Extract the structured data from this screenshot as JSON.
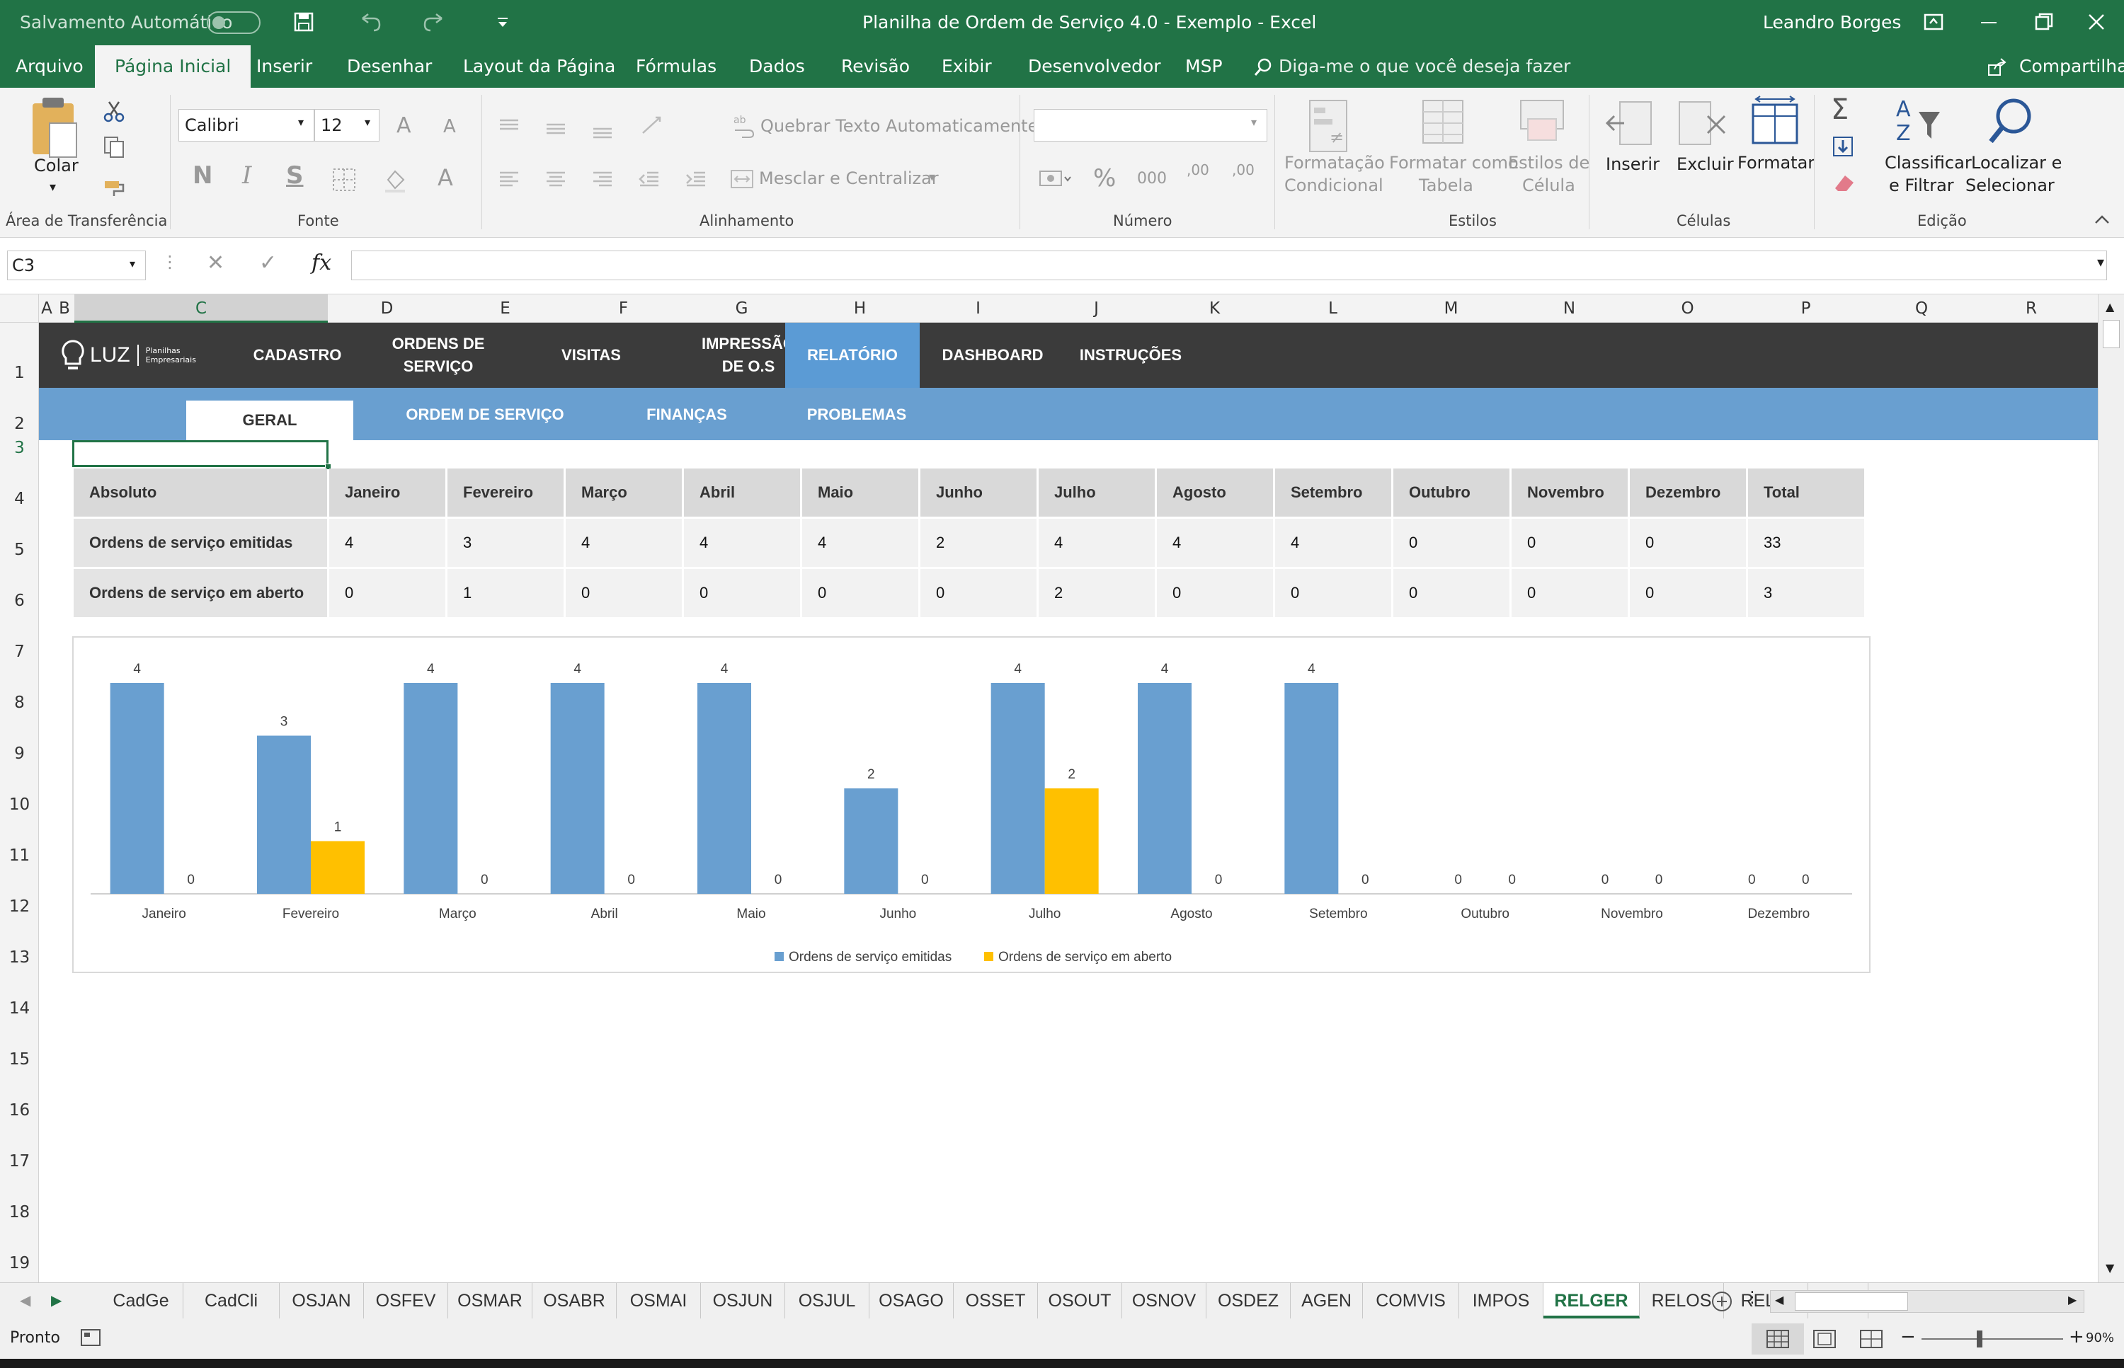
{
  "colors": {
    "excel_green": "#217346",
    "series_blue": "#699fd0",
    "series_yellow": "#ffc000",
    "nav_dark": "#3b3b3b",
    "nav_active": "#5b9bd5"
  },
  "titlebar": {
    "autosave_label": "Salvamento Automático",
    "window_title": "Planilha de Ordem de Serviço 4.0 - Exemplo  -  Excel",
    "user": "Leandro Borges",
    "share": "Compartilhar",
    "icons": [
      "save-icon",
      "undo-icon",
      "redo-icon",
      "customize-icon",
      "ribbon-display-icon",
      "minimize-icon",
      "restore-icon",
      "close-icon"
    ]
  },
  "ribbon_tabs": [
    "Arquivo",
    "Página Inicial",
    "Inserir",
    "Desenhar",
    "Layout da Página",
    "Fórmulas",
    "Dados",
    "Revisão",
    "Exibir",
    "Desenvolvedor",
    "MSP"
  ],
  "tell_me": "Diga-me o que você deseja fazer",
  "ribbon": {
    "clipboard": {
      "paste": "Colar",
      "label": "Área de Transferência"
    },
    "font": {
      "name": "Calibri",
      "size": "12",
      "bold": "N",
      "italic": "I",
      "underline": "S",
      "label": "Fonte"
    },
    "alignment": {
      "wrap": "Quebrar Texto Automaticamente",
      "merge": "Mesclar e Centralizar",
      "label": "Alinhamento"
    },
    "number": {
      "format": "",
      "percent": "%",
      "thousands": "000",
      "inc_decimal": ",00",
      "dec_decimal": ",00",
      "label": "Número"
    },
    "styles": {
      "conditional": "Formatação",
      "conditional2": "Condicional",
      "table": "Formatar como",
      "table2": "Tabela",
      "cell": "Estilos de",
      "cell2": "Célula",
      "label": "Estilos"
    },
    "cells": {
      "insert": "Inserir",
      "delete": "Excluir",
      "format": "Formatar",
      "label": "Células"
    },
    "editing": {
      "sort": "Classificar",
      "sort2": "e Filtrar",
      "find": "Localizar e",
      "find2": "Selecionar",
      "label": "Edição"
    }
  },
  "formula_bar": {
    "name_box": "C3",
    "fx": "fx",
    "value": ""
  },
  "columns": [
    "A",
    "B",
    "C",
    "D",
    "E",
    "F",
    "G",
    "H",
    "I",
    "J",
    "K",
    "L",
    "M",
    "N",
    "O",
    "P",
    "Q",
    "R"
  ],
  "rows": [
    "1",
    "2",
    "3",
    "4",
    "5",
    "6",
    "7",
    "8",
    "9",
    "10",
    "11",
    "12",
    "13",
    "14",
    "15",
    "16",
    "17",
    "18",
    "19"
  ],
  "nav": {
    "logo": "LUZ",
    "logo_sub": "Planilhas Empresariais",
    "items": [
      {
        "l1": "CADASTRO",
        "l2": ""
      },
      {
        "l1": "ORDENS DE",
        "l2": "SERVIÇO"
      },
      {
        "l1": "VISITAS",
        "l2": ""
      },
      {
        "l1": "IMPRESSÃO",
        "l2": "DE O.S"
      },
      {
        "l1": "RELATÓRIO",
        "l2": ""
      },
      {
        "l1": "DASHBOARD",
        "l2": ""
      },
      {
        "l1": "INSTRUÇÕES",
        "l2": ""
      }
    ]
  },
  "subnav": [
    "GERAL",
    "ORDEM DE SERVIÇO",
    "FINANÇAS",
    "PROBLEMAS"
  ],
  "table": {
    "headers": [
      "Absoluto",
      "Janeiro",
      "Fevereiro",
      "Março",
      "Abril",
      "Maio",
      "Junho",
      "Julho",
      "Agosto",
      "Setembro",
      "Outubro",
      "Novembro",
      "Dezembro",
      "Total"
    ],
    "rows": [
      {
        "label": "Ordens de serviço emitidas",
        "values": [
          "4",
          "3",
          "4",
          "4",
          "4",
          "2",
          "4",
          "4",
          "4",
          "0",
          "0",
          "0",
          "33"
        ]
      },
      {
        "label": "Ordens de serviço em aberto",
        "values": [
          "0",
          "1",
          "0",
          "0",
          "0",
          "0",
          "2",
          "0",
          "0",
          "0",
          "0",
          "0",
          "3"
        ]
      }
    ]
  },
  "chart_data": {
    "type": "bar",
    "categories": [
      "Janeiro",
      "Fevereiro",
      "Março",
      "Abril",
      "Maio",
      "Junho",
      "Julho",
      "Agosto",
      "Setembro",
      "Outubro",
      "Novembro",
      "Dezembro"
    ],
    "series": [
      {
        "name": "Ordens de serviço emitidas",
        "values": [
          4,
          3,
          4,
          4,
          4,
          2,
          4,
          4,
          4,
          0,
          0,
          0
        ],
        "color": "#699fd0"
      },
      {
        "name": "Ordens de serviço em aberto",
        "values": [
          0,
          1,
          0,
          0,
          0,
          0,
          2,
          0,
          0,
          0,
          0,
          0
        ],
        "color": "#ffc000"
      }
    ],
    "ylim": [
      0,
      4
    ],
    "legend": "bottom",
    "data_labels": true,
    "grid": false
  },
  "sheet_tabs": [
    "CadGe",
    "CadCli",
    "OSJAN",
    "OSFEV",
    "OSMAR",
    "OSABR",
    "OSMAI",
    "OSJUN",
    "OSJUL",
    "OSAGO",
    "OSSET",
    "OSOUT",
    "OSNOV",
    "OSDEZ",
    "AGEN",
    "COMVIS",
    "IMPOS",
    "RELGER",
    "RELOS",
    "RELFI",
    "..."
  ],
  "active_sheet": "RELGER",
  "status": {
    "ready": "Pronto",
    "zoom": "90%"
  }
}
